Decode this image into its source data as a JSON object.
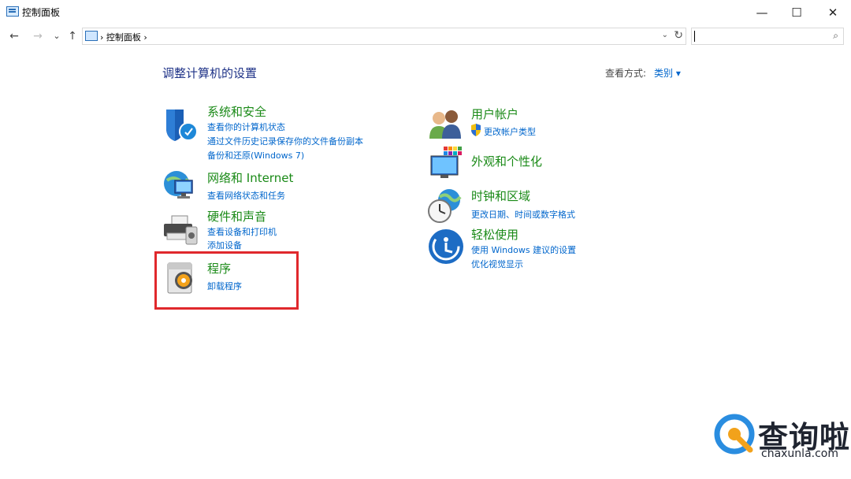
{
  "window": {
    "title": "控制面板",
    "minimize_glyph": "—",
    "maximize_glyph": "☐",
    "close_glyph": "✕"
  },
  "nav": {
    "back": "←",
    "forward": "→",
    "recent": "⌄",
    "up": "↑",
    "address": "›  控制面板  ›",
    "dropdown": "⌄",
    "refresh": "↻",
    "search_placeholder": "",
    "search_icon": "⌕"
  },
  "main": {
    "heading": "调整计算机的设置",
    "view_by_label": "查看方式:",
    "view_by_value": "类别 ▾",
    "left": [
      {
        "title": "系统和安全",
        "links": [
          "查看你的计算机状态",
          "通过文件历史记录保存你的文件备份副本",
          "备份和还原(Windows 7)"
        ]
      },
      {
        "title": "网络和 Internet",
        "links": [
          "查看网络状态和任务"
        ]
      },
      {
        "title": "硬件和声音",
        "links": [
          "查看设备和打印机",
          "添加设备"
        ]
      },
      {
        "title": "程序",
        "links": [
          "卸载程序"
        ]
      }
    ],
    "right": [
      {
        "title": "用户帐户",
        "links": [
          "更改帐户类型"
        ]
      },
      {
        "title": "外观和个性化",
        "links": []
      },
      {
        "title": "时钟和区域",
        "links": [
          "更改日期、时间或数字格式"
        ]
      },
      {
        "title": "轻松使用",
        "links": [
          "使用 Windows 建议的设置",
          "优化视觉显示"
        ]
      }
    ]
  },
  "watermark": {
    "text": "查询啦",
    "url": "chaxunla.com"
  },
  "colors": {
    "category_title": "#1a8a17",
    "link": "#0066cc",
    "heading": "#1e3287",
    "highlight": "#e0282c"
  }
}
